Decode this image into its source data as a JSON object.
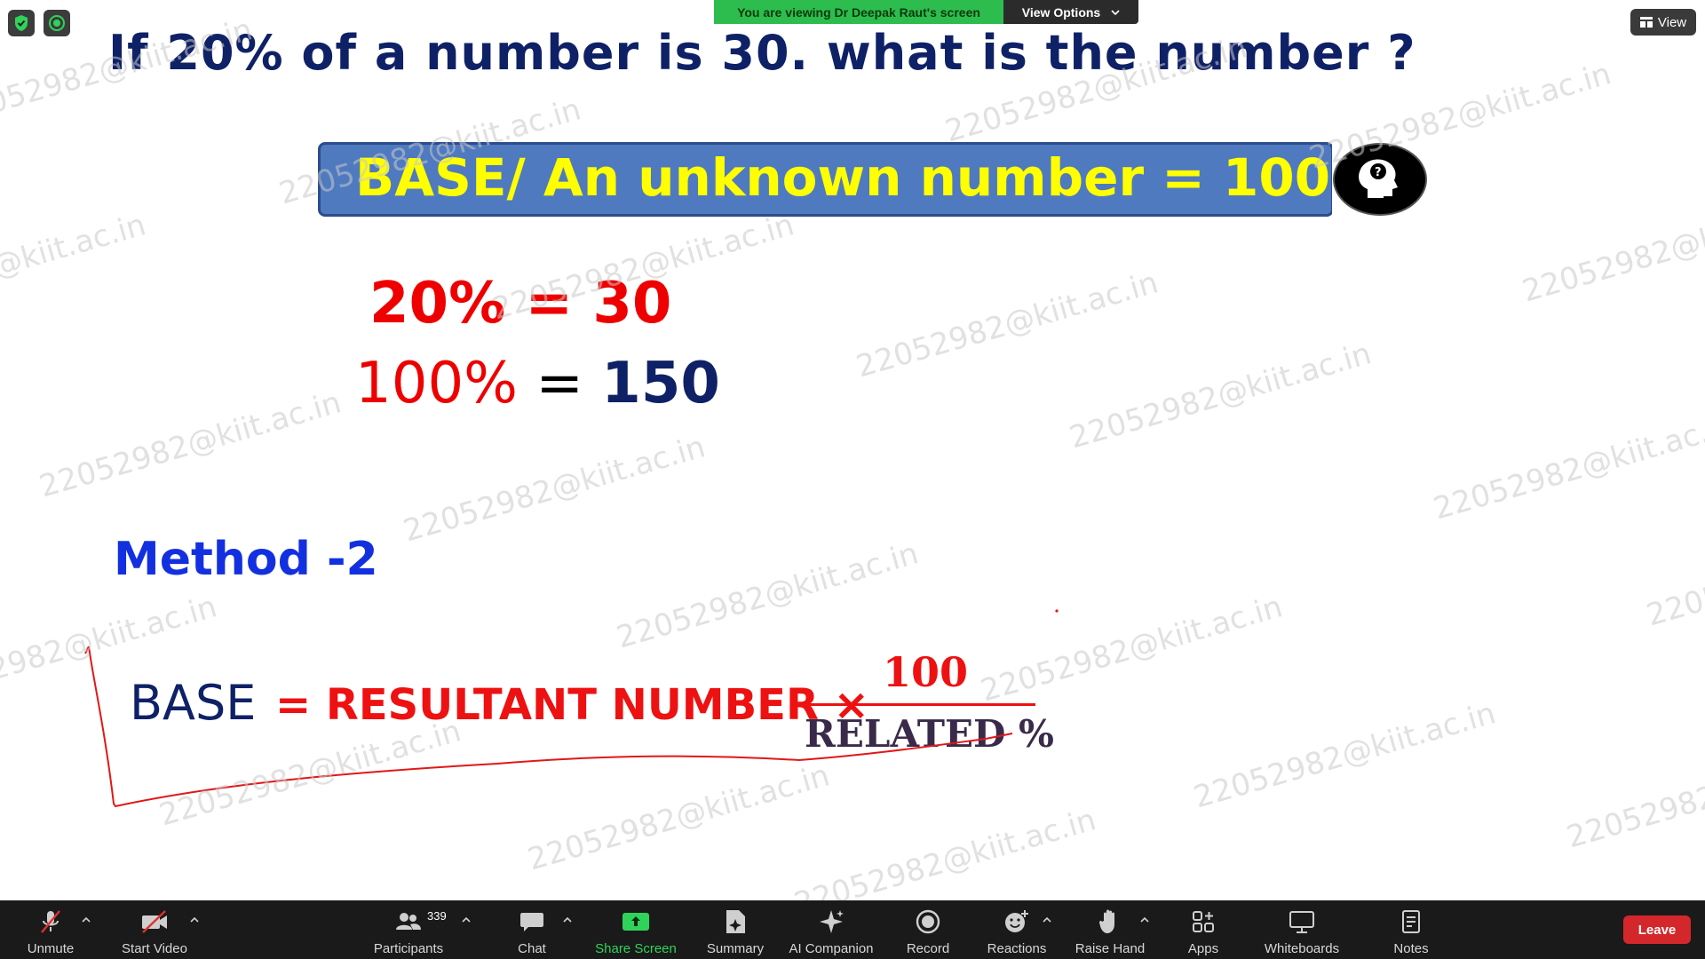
{
  "share_banner": {
    "viewing_text": "You are viewing Dr Deepak Raut's screen",
    "view_options_label": "View Options",
    "view_label": "View"
  },
  "slide": {
    "title": "If 20%  of a number is 30. what is the number ?",
    "base_banner": "BASE/  An unknown number = 100 %",
    "eq1": "20% = 30",
    "eq2_percent": "100%",
    "eq2_equals": "=",
    "eq2_value": "150",
    "method_heading": "Method -2",
    "formula_base": "BASE",
    "formula_rhs": "= RESULTANT NUMBER ×",
    "fraction_numerator": "100",
    "fraction_denominator": "RELATED %",
    "watermark": "22052982@kiit.ac.in"
  },
  "toolbar": {
    "unmute": "Unmute",
    "start_video": "Start Video",
    "participants": "Participants",
    "participants_count": "339",
    "chat": "Chat",
    "share_screen": "Share Screen",
    "summary": "Summary",
    "ai_companion": "AI Companion",
    "record": "Record",
    "reactions": "Reactions",
    "raise_hand": "Raise Hand",
    "apps": "Apps",
    "whiteboards": "Whiteboards",
    "notes": "Notes",
    "leave": "Leave"
  },
  "colors": {
    "title_navy": "#0f2166",
    "banner_blue": "#4f7ac0",
    "banner_text_yellow": "#ffff00",
    "equation_red": "#ee0000",
    "method_blue": "#1330e0",
    "share_green": "#2fd35a",
    "leave_red": "#d4272b",
    "toolbar_bg": "#1a1a1a"
  }
}
